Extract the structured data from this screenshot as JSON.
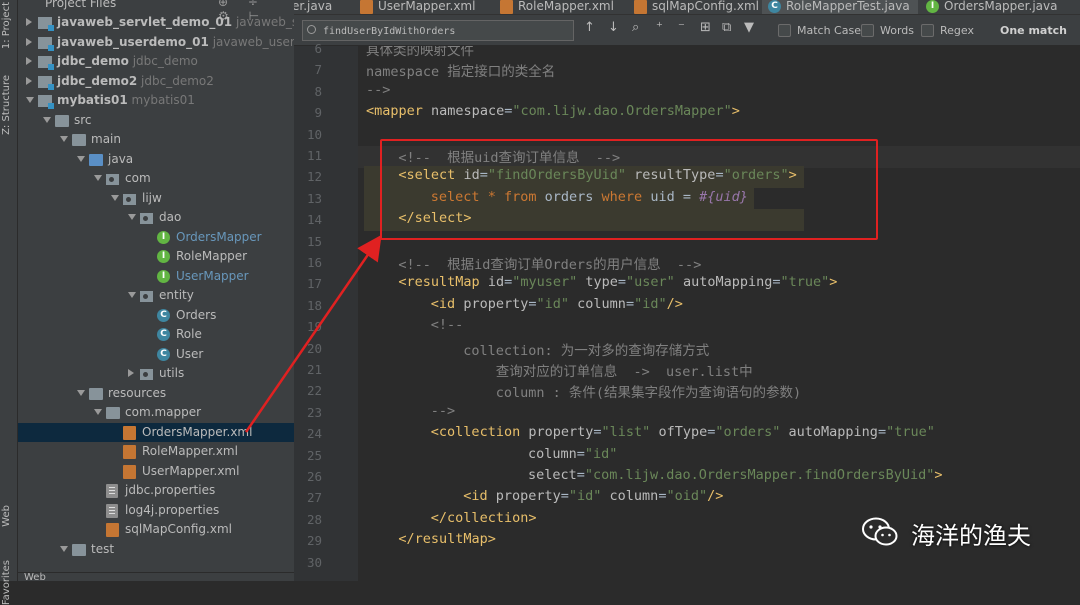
{
  "side_strip": {
    "tabs": [
      "1: Project",
      "Z: Structure",
      "Web",
      "Favorites"
    ]
  },
  "project_panel": {
    "title": "Project Files",
    "tools": "⊕ ÷ ⚙ ⊢",
    "tree": [
      {
        "label": "javaweb_servlet_demo_01",
        "hint": "javaweb_servlet",
        "icon": "module",
        "arrow": "right",
        "bold": true,
        "indent": 0
      },
      {
        "label": "javaweb_userdemo_01",
        "hint": "javaweb_userdemo",
        "icon": "module",
        "arrow": "right",
        "bold": true,
        "indent": 0
      },
      {
        "label": "jdbc_demo",
        "hint": "jdbc_demo",
        "icon": "module",
        "arrow": "right",
        "bold": true,
        "indent": 0
      },
      {
        "label": "jdbc_demo2",
        "hint": "jdbc_demo2",
        "icon": "module",
        "arrow": "right",
        "bold": true,
        "indent": 0
      },
      {
        "label": "mybatis01",
        "hint": "mybatis01",
        "icon": "module",
        "arrow": "down",
        "bold": true,
        "indent": 0
      },
      {
        "label": "src",
        "icon": "folder",
        "arrow": "down",
        "indent": 1
      },
      {
        "label": "main",
        "icon": "folder",
        "arrow": "down",
        "indent": 2
      },
      {
        "label": "java",
        "icon": "folder-blue",
        "arrow": "down",
        "indent": 3
      },
      {
        "label": "com",
        "icon": "pkg",
        "arrow": "down",
        "indent": 4
      },
      {
        "label": "lijw",
        "icon": "pkg",
        "arrow": "down",
        "indent": 5
      },
      {
        "label": "dao",
        "icon": "pkg",
        "arrow": "down",
        "indent": 6
      },
      {
        "label": "OrdersMapper",
        "icon": "interface",
        "indent": 7,
        "blue": true
      },
      {
        "label": "RoleMapper",
        "icon": "interface",
        "indent": 7
      },
      {
        "label": "UserMapper",
        "icon": "interface",
        "indent": 7,
        "blue": true
      },
      {
        "label": "entity",
        "icon": "pkg",
        "arrow": "down",
        "indent": 6
      },
      {
        "label": "Orders",
        "icon": "class",
        "indent": 7
      },
      {
        "label": "Role",
        "icon": "class",
        "indent": 7
      },
      {
        "label": "User",
        "icon": "class",
        "indent": 7
      },
      {
        "label": "utils",
        "icon": "pkg",
        "arrow": "right",
        "indent": 6
      },
      {
        "label": "resources",
        "icon": "folder",
        "arrow": "down",
        "indent": 3
      },
      {
        "label": "com.mapper",
        "icon": "folder",
        "arrow": "down",
        "indent": 4
      },
      {
        "label": "OrdersMapper.xml",
        "icon": "xml",
        "indent": 5,
        "selected": true
      },
      {
        "label": "RoleMapper.xml",
        "icon": "xml",
        "indent": 5
      },
      {
        "label": "UserMapper.xml",
        "icon": "xml",
        "indent": 5
      },
      {
        "label": "jdbc.properties",
        "icon": "props",
        "indent": 4
      },
      {
        "label": "log4j.properties",
        "icon": "props",
        "indent": 4
      },
      {
        "label": "sqlMapConfig.xml",
        "icon": "xml",
        "indent": 4
      },
      {
        "label": "test",
        "icon": "folder",
        "arrow": "down",
        "indent": 2
      }
    ],
    "bottom_label": "Web"
  },
  "tabs": [
    {
      "label": "er.java",
      "icon": "class"
    },
    {
      "label": "UserMapper.xml",
      "icon": "xml"
    },
    {
      "label": "RoleMapper.xml",
      "icon": "xml"
    },
    {
      "label": "sqlMapConfig.xml",
      "icon": "xml"
    },
    {
      "label": "RoleMapperTest.java",
      "icon": "class",
      "active": true
    },
    {
      "label": "OrdersMapper.java",
      "icon": "interface"
    }
  ],
  "search": {
    "value": "findUserByIdWithOrders",
    "buttons": [
      "↑",
      "↓",
      "⌕",
      "⁺",
      "⁻",
      "⊞",
      "⧉",
      "⊟",
      "⊞",
      "▼"
    ],
    "options": [
      {
        "label": "Match Case",
        "checked": false
      },
      {
        "label": "Words",
        "checked": false
      },
      {
        "label": "Regex",
        "checked": false
      }
    ],
    "result": "One match"
  },
  "editor": {
    "lines": [
      {
        "n": 6,
        "html": "<span class='cm'>具体类的映射文件</span>",
        "indent": 0
      },
      {
        "n": 7,
        "html": "<span class='cm'>namespace 指定接口的类全名</span>",
        "indent": 0
      },
      {
        "n": 8,
        "html": "<span class='cm'>--&gt;</span>",
        "indent": 0
      },
      {
        "n": 9,
        "html": "<span class='tag'>&lt;mapper</span> <span class='attr'>namespace</span>=<span class='val'>\"com.lijw.dao.OrdersMapper\"</span><span class='tag'>&gt;</span>",
        "indent": 0
      },
      {
        "n": 10,
        "html": "",
        "indent": 0
      },
      {
        "n": 11,
        "html": "<span class='cm'>&lt;!--  根据uid查询订单信息  --&gt;</span>",
        "indent": 1,
        "caret": true
      },
      {
        "n": 12,
        "html": "<span class='tag'>&lt;select</span> <span class='attr'>id</span>=<span class='val'>\"findOrdersByUid\"</span> <span class='attr'>resultType</span>=<span class='val'>\"orders\"</span><span class='tag'>&gt;</span>",
        "indent": 1,
        "hl": true
      },
      {
        "n": 13,
        "html": "<span class='kw'>select</span> <span class='kw'>*</span> <span class='kw'>from</span> orders <span class='kw'>where</span> uid = <span class='cn'>#{uid}</span>",
        "indent": 2,
        "hl": true
      },
      {
        "n": 14,
        "html": "<span class='tag'>&lt;/select&gt;</span>",
        "indent": 1,
        "hl": true
      },
      {
        "n": 15,
        "html": "",
        "indent": 0
      },
      {
        "n": 16,
        "html": "<span class='cm'>&lt;!--  根据id查询订单Orders的用户信息  --&gt;</span>",
        "indent": 1
      },
      {
        "n": 17,
        "html": "<span class='tag'>&lt;resultMap</span> <span class='attr'>id</span>=<span class='val'>\"myuser\"</span> <span class='attr'>type</span>=<span class='val'>\"user\"</span> <span class='attr'>autoMapping</span>=<span class='val'>\"true\"</span><span class='tag'>&gt;</span>",
        "indent": 1
      },
      {
        "n": 18,
        "html": "<span class='tag'>&lt;id</span> <span class='attr'>property</span>=<span class='val'>\"id\"</span> <span class='attr'>column</span>=<span class='val'>\"id\"</span><span class='tag'>/&gt;</span>",
        "indent": 2
      },
      {
        "n": 19,
        "html": "<span class='cm'>&lt;!--</span>",
        "indent": 2
      },
      {
        "n": 20,
        "html": "<span class='cm'>collection: 为一对多的查询存储方式</span>",
        "indent": 3
      },
      {
        "n": 21,
        "html": "<span class='cm'>    查询对应的订单信息  -&gt;  user.list中</span>",
        "indent": 3
      },
      {
        "n": 22,
        "html": "<span class='cm'>    column : 条件(结果集字段作为查询语句的参数)</span>",
        "indent": 3
      },
      {
        "n": 23,
        "html": "<span class='cm'>--&gt;</span>",
        "indent": 2
      },
      {
        "n": 24,
        "html": "<span class='tag'>&lt;collection</span> <span class='attr'>property</span>=<span class='val'>\"list\"</span> <span class='attr'>ofType</span>=<span class='val'>\"orders\"</span> <span class='attr'>autoMapping</span>=<span class='val'>\"true\"</span>",
        "indent": 2
      },
      {
        "n": 25,
        "html": "<span class='attr'>column</span>=<span class='val'>\"id\"</span>",
        "indent": 5
      },
      {
        "n": 26,
        "html": "<span class='attr'>select</span>=<span class='val'>\"com.lijw.dao.OrdersMapper.findOrdersByUid\"</span><span class='tag'>&gt;</span>",
        "indent": 5
      },
      {
        "n": 27,
        "html": "<span class='tag'>&lt;id</span> <span class='attr'>property</span>=<span class='val'>\"id\"</span> <span class='attr'>column</span>=<span class='val'>\"oid\"</span><span class='tag'>/&gt;</span>",
        "indent": 3
      },
      {
        "n": 28,
        "html": "<span class='tag'>&lt;/collection&gt;</span>",
        "indent": 2
      },
      {
        "n": 29,
        "html": "<span class='tag'>&lt;/resultMap&gt;</span>",
        "indent": 1
      },
      {
        "n": 30,
        "html": "",
        "indent": 0
      }
    ]
  },
  "watermark": {
    "text": "海洋的渔夫",
    "icon": "wechat-icon"
  }
}
